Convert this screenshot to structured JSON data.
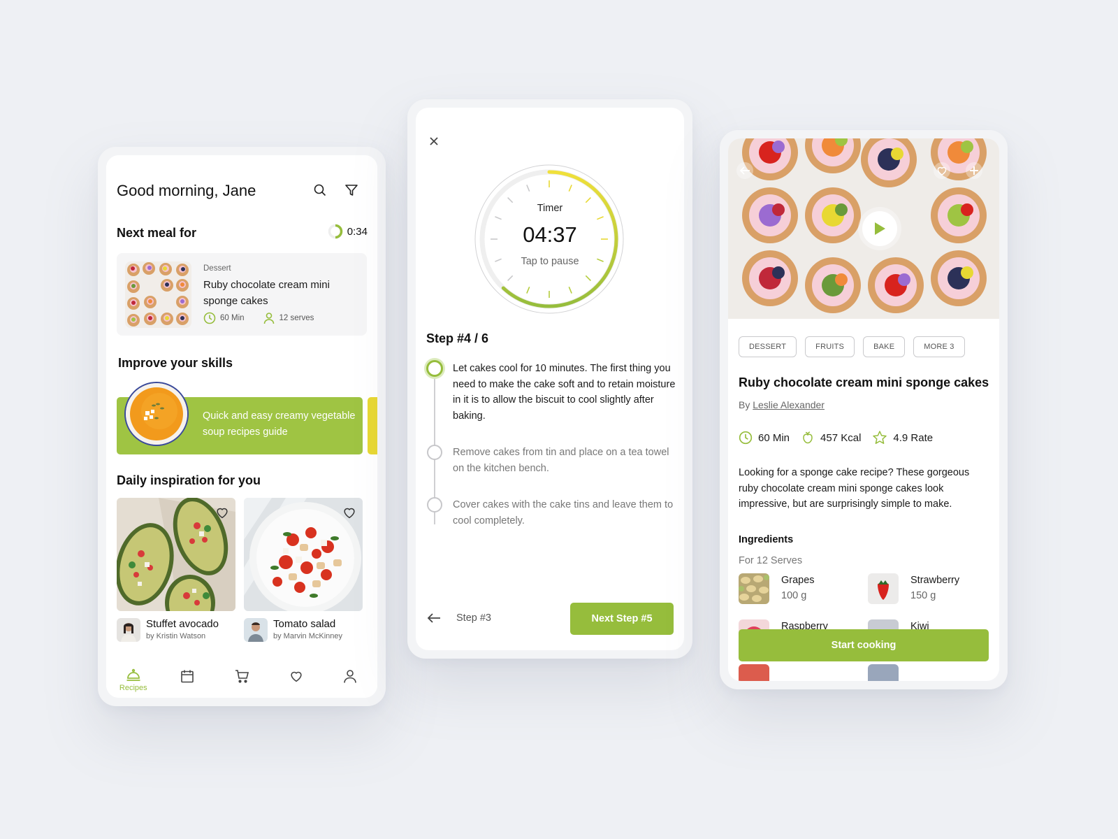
{
  "theme": {
    "accent": "#96bd3c",
    "accent_light": "#9fc443",
    "secondary_card": "#e8d833",
    "background": "#eef0f4"
  },
  "home": {
    "greeting": "Good morning, Jane",
    "icons": [
      "search-icon",
      "filter-icon"
    ],
    "next_meal": {
      "heading": "Next meal for",
      "countdown": "0:34",
      "countdown_progress": 0.5,
      "card": {
        "category": "Dessert",
        "name": "Ruby chocolate cream mini sponge cakes",
        "time": "60 Min",
        "serves": "12 serves"
      }
    },
    "skills": {
      "heading": "Improve your skills",
      "cards": [
        {
          "text": "Quick and easy creamy vegetable soup recipes guide",
          "color": "#9fc443"
        },
        {
          "text": "",
          "color": "#e8d833"
        }
      ]
    },
    "daily": {
      "heading": "Daily inspiration for you",
      "items": [
        {
          "title": "Stuffet avocado",
          "author": "by Kristin Watson"
        },
        {
          "title": "Tomato salad",
          "author": "by Marvin McKinney"
        }
      ]
    },
    "tabbar": [
      {
        "id": "recipes",
        "label": "Recipes",
        "icon": "cloche-icon",
        "active": true
      },
      {
        "id": "calendar",
        "label": "",
        "icon": "calendar-icon",
        "active": false
      },
      {
        "id": "cart",
        "label": "",
        "icon": "cart-icon",
        "active": false
      },
      {
        "id": "favorites",
        "label": "",
        "icon": "heart-icon",
        "active": false
      },
      {
        "id": "profile",
        "label": "",
        "icon": "user-icon",
        "active": false
      }
    ]
  },
  "cooking": {
    "timer": {
      "label": "Timer",
      "value": "04:37",
      "hint": "Tap to pause",
      "progress": 0.62
    },
    "step_heading": "Step #4 / 6",
    "steps": [
      {
        "text": "Let cakes cool for 10 minutes. The first thing you need to make the cake soft and to retain moisture in it is to allow the biscuit to cool slightly after baking.",
        "active": true
      },
      {
        "text": "Remove cakes from tin and place on a tea towel on the kitchen bench.",
        "active": false
      },
      {
        "text": "Cover cakes with the cake tins and leave them to cool completely.",
        "active": false
      }
    ],
    "prev_label": "Step #3",
    "next_label": "Next Step #5"
  },
  "recipe": {
    "tags": [
      "DESSERT",
      "FRUITS",
      "BAKE",
      "MORE 3"
    ],
    "title": "Ruby chocolate cream mini sponge cakes",
    "by_prefix": "By",
    "author": "Leslie Alexander",
    "stats": {
      "time": "60 Min",
      "calories": "457 Kcal",
      "rating": "4.9 Rate"
    },
    "description": "Looking for a sponge cake recipe? These gorgeous ruby chocolate cream mini sponge cakes look impressive, but are surprisingly simple to make.",
    "ingredients_heading": "Ingredients",
    "ingredients_sub": "For 12 Serves",
    "ingredients": [
      {
        "name": "Grapes",
        "amount": "100 g"
      },
      {
        "name": "Strawberry",
        "amount": "150 g"
      },
      {
        "name": "Raspberry",
        "amount": ""
      },
      {
        "name": "Kiwi",
        "amount": ""
      }
    ],
    "start_label": "Start cooking"
  }
}
